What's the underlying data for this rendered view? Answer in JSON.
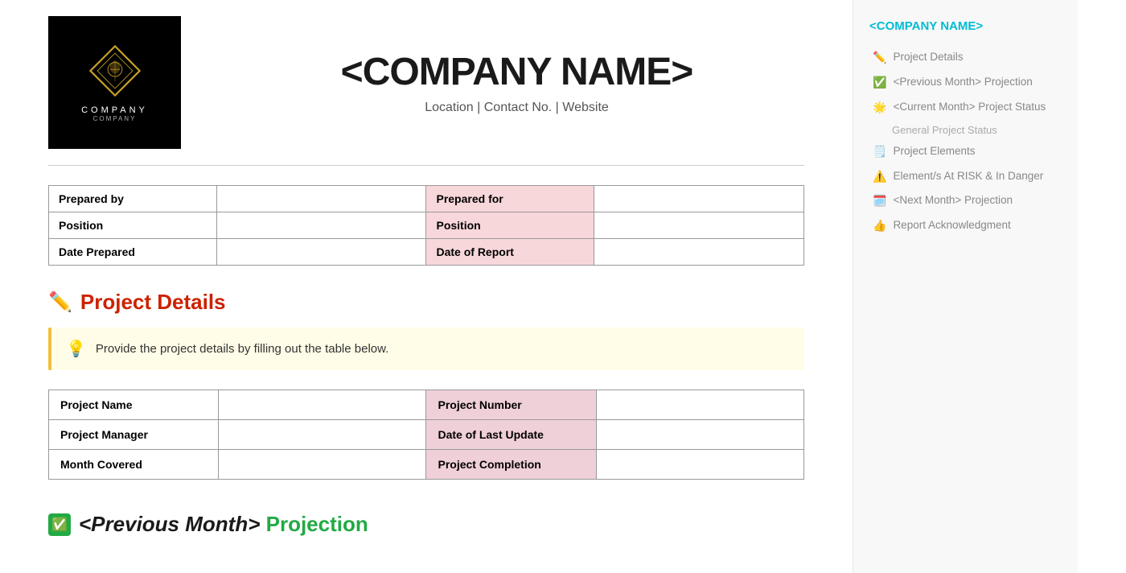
{
  "header": {
    "logo_text": "COMPANY",
    "logo_sub": "COMPANY",
    "company_name": "<COMPANY NAME>",
    "company_subtitle": "Location | Contact No. | Website"
  },
  "info_table": {
    "rows": [
      {
        "label1": "Prepared by",
        "value1": "",
        "label2": "Prepared for",
        "value2": ""
      },
      {
        "label1": "Position",
        "value1": "",
        "label2": "Position",
        "value2": ""
      },
      {
        "label1": "Date Prepared",
        "value1": "",
        "label2": "Date of Report",
        "value2": ""
      }
    ]
  },
  "project_details": {
    "section_icon": "✏️",
    "section_title": "Project Details",
    "hint_icon": "💡",
    "hint_text": "Provide the project details by filling out the table below.",
    "rows": [
      {
        "label1": "Project Name",
        "value1": "",
        "label2": "Project Number",
        "value2": ""
      },
      {
        "label1": "Project Manager",
        "value1": "",
        "label2": "Date of Last Update",
        "value2": ""
      },
      {
        "label1": "Month Covered",
        "value1": "",
        "label2": "Project Completion",
        "value2": ""
      }
    ]
  },
  "previous_month": {
    "section_icon": "✅",
    "section_title_part1": "<Previous Month>",
    "section_title_part2": " Projection"
  },
  "sidebar": {
    "company_name": "<COMPANY NAME>",
    "items": [
      {
        "icon": "✏️",
        "label": "Project Details"
      },
      {
        "icon": "✅",
        "label": "<Previous Month> Projection"
      },
      {
        "icon": "🌟",
        "label": "<Current Month> Project Status"
      },
      {
        "icon": "",
        "label": "General Project Status",
        "is_sub": true
      },
      {
        "icon": "🗒️",
        "label": "Project Elements"
      },
      {
        "icon": "⚠️",
        "label": "Element/s At RISK & In Danger"
      },
      {
        "icon": "🗓️",
        "label": "<Next Month> Projection"
      },
      {
        "icon": "👍",
        "label": "Report Acknowledgment"
      }
    ]
  }
}
